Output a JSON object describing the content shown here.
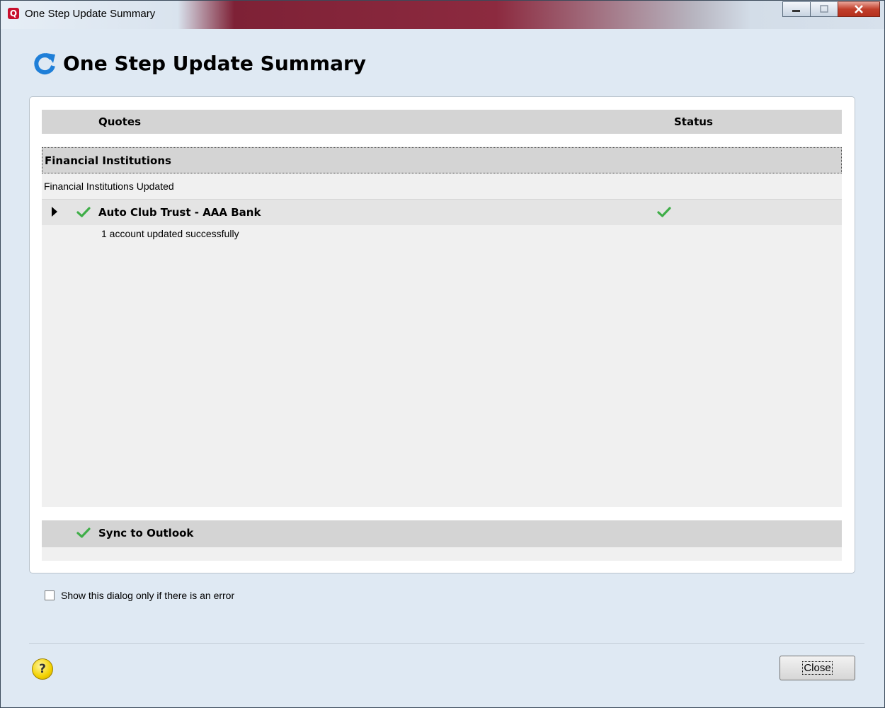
{
  "window": {
    "title": "One Step Update Summary",
    "app_icon_letter": "Q"
  },
  "header": {
    "title": "One Step Update Summary"
  },
  "table": {
    "columns": [
      "Quotes",
      "Status"
    ]
  },
  "group": {
    "title": "Financial Institutions",
    "subtitle": "Financial Institutions Updated",
    "items": [
      {
        "name": "Auto Club Trust - AAA Bank",
        "detail": "1 account updated successfully",
        "status_icon": "check-icon"
      }
    ]
  },
  "sync": {
    "label": "Sync to Outlook",
    "status_icon": "check-icon"
  },
  "options": {
    "show_only_on_error_label": "Show this dialog only if there is an error",
    "show_only_on_error_checked": false
  },
  "footer": {
    "help_icon": "?",
    "close_label": "Close"
  },
  "colors": {
    "check_green": "#3fae48",
    "refresh_blue": "#1f7fd8"
  }
}
